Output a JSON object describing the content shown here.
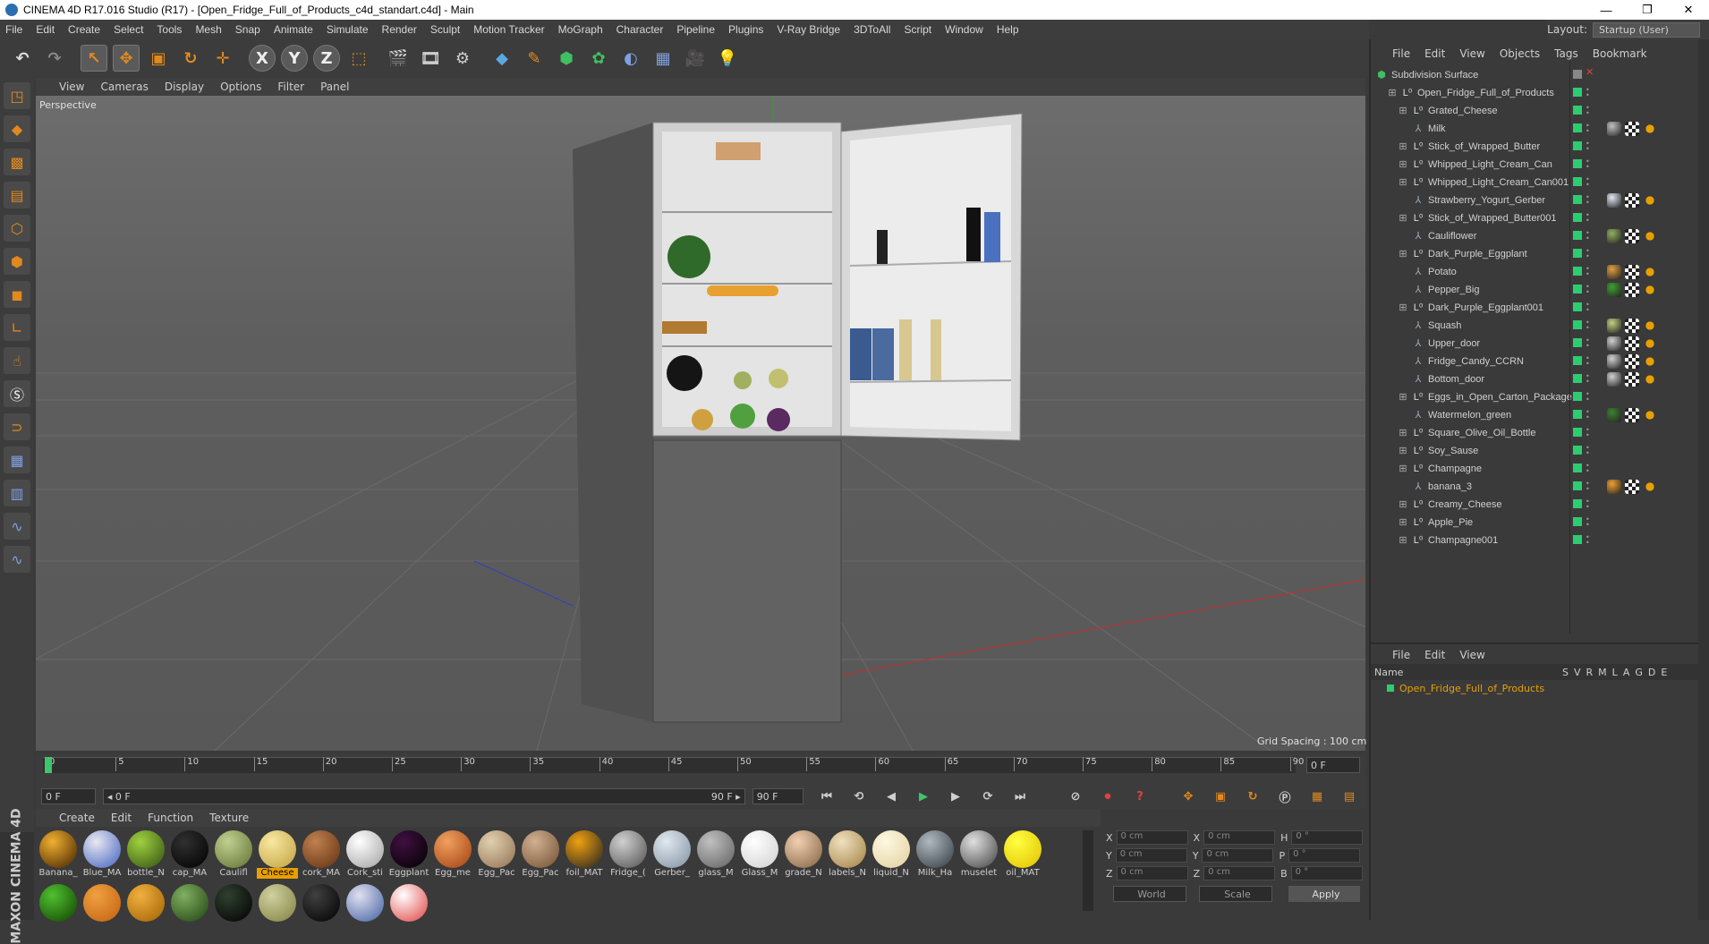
{
  "title": "CINEMA 4D R17.016 Studio (R17) - [Open_Fridge_Full_of_Products_c4d_standart.c4d] - Main",
  "window_controls": [
    "—",
    "❐",
    "✕"
  ],
  "menu": [
    "File",
    "Edit",
    "Create",
    "Select",
    "Tools",
    "Mesh",
    "Snap",
    "Animate",
    "Simulate",
    "Render",
    "Sculpt",
    "Motion Tracker",
    "MoGraph",
    "Character",
    "Pipeline",
    "Plugins",
    "V-Ray Bridge",
    "3DToAll",
    "Script",
    "Window",
    "Help"
  ],
  "layout": {
    "label": "Layout:",
    "value": "Startup (User)"
  },
  "toolbar": {
    "undo": "↶",
    "redo": "↷",
    "select": "↖",
    "move": "✥",
    "scale": "▣",
    "rotate": "↻",
    "transform": "✛",
    "x": "X",
    "y": "Y",
    "z": "Z",
    "coord": "⬚",
    "render_view": "🎬",
    "render_pic": "🎞",
    "render_settings": "⚙",
    "cube": "◆",
    "pen": "✎",
    "subdiv": "⬢",
    "cloner": "✿",
    "deformer": "◐",
    "floor": "▦",
    "camera": "🎥",
    "light": "💡"
  },
  "viewport": {
    "menu": [
      "View",
      "Cameras",
      "Display",
      "Options",
      "Filter",
      "Panel"
    ],
    "label": "Perspective",
    "grid_spacing": "Grid Spacing : 100 cm"
  },
  "timeline": {
    "ticks": [
      "0",
      "5",
      "10",
      "15",
      "20",
      "25",
      "30",
      "35",
      "40",
      "45",
      "50",
      "55",
      "60",
      "65",
      "70",
      "75",
      "80",
      "85",
      "90"
    ],
    "current_frame": "0 F",
    "start": "0 F",
    "range_start": "◂ 0 F",
    "range_end": "90 F ▸",
    "end": "90 F"
  },
  "materials": {
    "menu": [
      "Create",
      "Edit",
      "Function",
      "Texture"
    ],
    "items": [
      {
        "label": "Banana_",
        "c1": "#f0b030",
        "c2": "#402000"
      },
      {
        "label": "Blue_MA",
        "c1": "#e8e8f0",
        "c2": "#4060c0"
      },
      {
        "label": "bottle_N",
        "c1": "#a0d040",
        "c2": "#305010"
      },
      {
        "label": "cap_MA",
        "c1": "#303030",
        "c2": "#000000"
      },
      {
        "label": "Caulifl",
        "c1": "#c0d090",
        "c2": "#607030"
      },
      {
        "label": "Cheese",
        "c1": "#f8e8a0",
        "c2": "#c0a040"
      },
      {
        "label": "cork_MA",
        "c1": "#c08050",
        "c2": "#603010"
      },
      {
        "label": "Cork_sti",
        "c1": "#ffffff",
        "c2": "#a0a0a0"
      },
      {
        "label": "Eggplant",
        "c1": "#401040",
        "c2": "#000000"
      },
      {
        "label": "Egg_me",
        "c1": "#f0a060",
        "c2": "#a04010"
      },
      {
        "label": "Egg_Pac",
        "c1": "#e0d0b0",
        "c2": "#907050"
      },
      {
        "label": "Egg_Pac",
        "c1": "#d0b090",
        "c2": "#705030"
      },
      {
        "label": "foil_MAT",
        "c1": "#f0a010",
        "c2": "#202020"
      },
      {
        "label": "Fridge_(",
        "c1": "#d0d0d0",
        "c2": "#505050"
      },
      {
        "label": "Gerber_",
        "c1": "#e0e8f0",
        "c2": "#8090a0"
      },
      {
        "label": "glass_M",
        "c1": "#c0c0c0",
        "c2": "#606060"
      },
      {
        "label": "Glass_M",
        "c1": "#ffffff",
        "c2": "#d0d0d0"
      },
      {
        "label": "grade_N",
        "c1": "#f0d0b0",
        "c2": "#806040"
      },
      {
        "label": "labels_N",
        "c1": "#f0e0c0",
        "c2": "#a08040"
      },
      {
        "label": "liquid_N",
        "c1": "#fff8e0",
        "c2": "#e0d0a0"
      },
      {
        "label": "Milk_Ha",
        "c1": "#b0b8c0",
        "c2": "#303840"
      },
      {
        "label": "muselet",
        "c1": "#e0e0e0",
        "c2": "#404040"
      },
      {
        "label": "oil_MAT",
        "c1": "#ffff40",
        "c2": "#e0c000"
      }
    ],
    "row2": [
      {
        "c1": "#50c030",
        "c2": "#104000"
      },
      {
        "c1": "#f0a040",
        "c2": "#c06010"
      },
      {
        "c1": "#f0b040",
        "c2": "#a06000"
      },
      {
        "c1": "#80b060",
        "c2": "#204010"
      },
      {
        "c1": "#304030",
        "c2": "#000000"
      },
      {
        "c1": "#d0d0a0",
        "c2": "#808040"
      },
      {
        "c1": "#404040",
        "c2": "#000000"
      },
      {
        "c1": "#e0e0f0",
        "c2": "#4060a0"
      },
      {
        "c1": "#ffffff",
        "c2": "#e04040"
      }
    ]
  },
  "coords": {
    "rows": [
      {
        "a": "X",
        "av": "0 cm",
        "b": "X",
        "bv": "0 cm",
        "c": "H",
        "cv": "0 °"
      },
      {
        "a": "Y",
        "av": "0 cm",
        "b": "Y",
        "bv": "0 cm",
        "c": "P",
        "cv": "0 °"
      },
      {
        "a": "Z",
        "av": "0 cm",
        "b": "Z",
        "bv": "0 cm",
        "c": "B",
        "cv": "0 °"
      }
    ],
    "world": "World",
    "scale": "Scale",
    "apply": "Apply"
  },
  "objects": {
    "menu": [
      "File",
      "Edit",
      "View",
      "Objects",
      "Tags",
      "Bookmark"
    ],
    "root": "Subdivision Surface",
    "items": [
      {
        "name": "Open_Fridge_Full_of_Products",
        "indent": 1,
        "type": "null",
        "tags": []
      },
      {
        "name": "Grated_Cheese",
        "indent": 2,
        "type": "null",
        "tags": []
      },
      {
        "name": "Milk",
        "indent": 2,
        "type": "bone",
        "tags": [
          "#c0c0c0",
          "#ffffff",
          "#e8a000"
        ]
      },
      {
        "name": "Stick_of_Wrapped_Butter",
        "indent": 2,
        "type": "null",
        "tags": []
      },
      {
        "name": "Whipped_Light_Cream_Can",
        "indent": 2,
        "type": "null",
        "tags": []
      },
      {
        "name": "Whipped_Light_Cream_Can001",
        "indent": 2,
        "type": "null",
        "tags": []
      },
      {
        "name": "Strawberry_Yogurt_Gerber",
        "indent": 2,
        "type": "bone",
        "tags": [
          "#e0e8f0",
          "#ffffff",
          "#e8a000"
        ]
      },
      {
        "name": "Stick_of_Wrapped_Butter001",
        "indent": 2,
        "type": "null",
        "tags": []
      },
      {
        "name": "Cauliflower",
        "indent": 2,
        "type": "bone",
        "tags": [
          "#90b060",
          "#ffffff",
          "#e8a000"
        ]
      },
      {
        "name": "Dark_Purple_Eggplant",
        "indent": 2,
        "type": "null",
        "tags": []
      },
      {
        "name": "Potato",
        "indent": 2,
        "type": "bone",
        "tags": [
          "#e0a040",
          "#ffffff",
          "#e8a000"
        ]
      },
      {
        "name": "Pepper_Big",
        "indent": 2,
        "type": "bone",
        "tags": [
          "#40a030",
          "#ffffff",
          "#e8a000"
        ]
      },
      {
        "name": "Dark_Purple_Eggplant001",
        "indent": 2,
        "type": "null",
        "tags": []
      },
      {
        "name": "Squash",
        "indent": 2,
        "type": "bone",
        "tags": [
          "#c0d080",
          "#ffffff",
          "#e8a000"
        ]
      },
      {
        "name": "Upper_door",
        "indent": 2,
        "type": "bone",
        "tags": [
          "#d0d0d0",
          "#ffffff",
          "#e8a000"
        ]
      },
      {
        "name": "Fridge_Candy_CCRN",
        "indent": 2,
        "type": "bone",
        "tags": [
          "#d0d0d0",
          "#ffffff",
          "#e8a000"
        ]
      },
      {
        "name": "Bottom_door",
        "indent": 2,
        "type": "bone",
        "tags": [
          "#d0d0d0",
          "#ffffff",
          "#e8a000"
        ]
      },
      {
        "name": "Eggs_in_Open_Carton_Package",
        "indent": 2,
        "type": "null",
        "tags": []
      },
      {
        "name": "Watermelon_green",
        "indent": 2,
        "type": "bone",
        "tags": [
          "#408030",
          "#ffffff",
          "#e8a000"
        ]
      },
      {
        "name": "Square_Olive_Oil_Bottle",
        "indent": 2,
        "type": "null",
        "tags": []
      },
      {
        "name": "Soy_Sause",
        "indent": 2,
        "type": "null",
        "tags": []
      },
      {
        "name": "Champagne",
        "indent": 2,
        "type": "null",
        "tags": []
      },
      {
        "name": "banana_3",
        "indent": 2,
        "type": "bone",
        "tags": [
          "#f0a030",
          "#ffffff",
          "#e8a000"
        ]
      },
      {
        "name": "Creamy_Cheese",
        "indent": 2,
        "type": "null",
        "tags": []
      },
      {
        "name": "Apple_Pie",
        "indent": 2,
        "type": "null",
        "tags": []
      },
      {
        "name": "Champagne001",
        "indent": 2,
        "type": "null",
        "tags": []
      }
    ]
  },
  "attributes": {
    "menu": [
      "File",
      "Edit",
      "View"
    ],
    "header": "Name",
    "cols": [
      "S",
      "V",
      "R",
      "M",
      "L",
      "A",
      "G",
      "D",
      "E"
    ],
    "row": "Open_Fridge_Full_of_Products"
  },
  "brand": "MAXON CINEMA 4D",
  "colors": {
    "accent": "#e8a000",
    "visible": "#2ecc71",
    "axis_x": "#c03030",
    "axis_z": "#3040c0",
    "axis_y": "#30a030"
  }
}
